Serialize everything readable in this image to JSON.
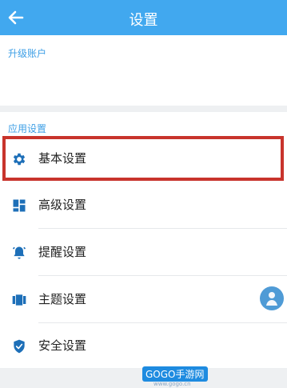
{
  "header": {
    "title": "设置",
    "back_icon": "arrow-left-icon",
    "background": "#41a8ef"
  },
  "upgrade": {
    "section_title": "升级账户"
  },
  "app_settings": {
    "section_title": "应用设置",
    "items": [
      {
        "label": "基本设置",
        "icon": "gear-icon"
      },
      {
        "label": "高级设置",
        "icon": "dashboard-icon"
      },
      {
        "label": "提醒设置",
        "icon": "bell-icon"
      },
      {
        "label": "主题设置",
        "icon": "theme-icon"
      },
      {
        "label": "安全设置",
        "icon": "shield-check-icon"
      }
    ]
  },
  "highlight_color": "#c8342c",
  "watermark": {
    "text": "GOGO手游网",
    "sub": "www.gogo.cn"
  }
}
